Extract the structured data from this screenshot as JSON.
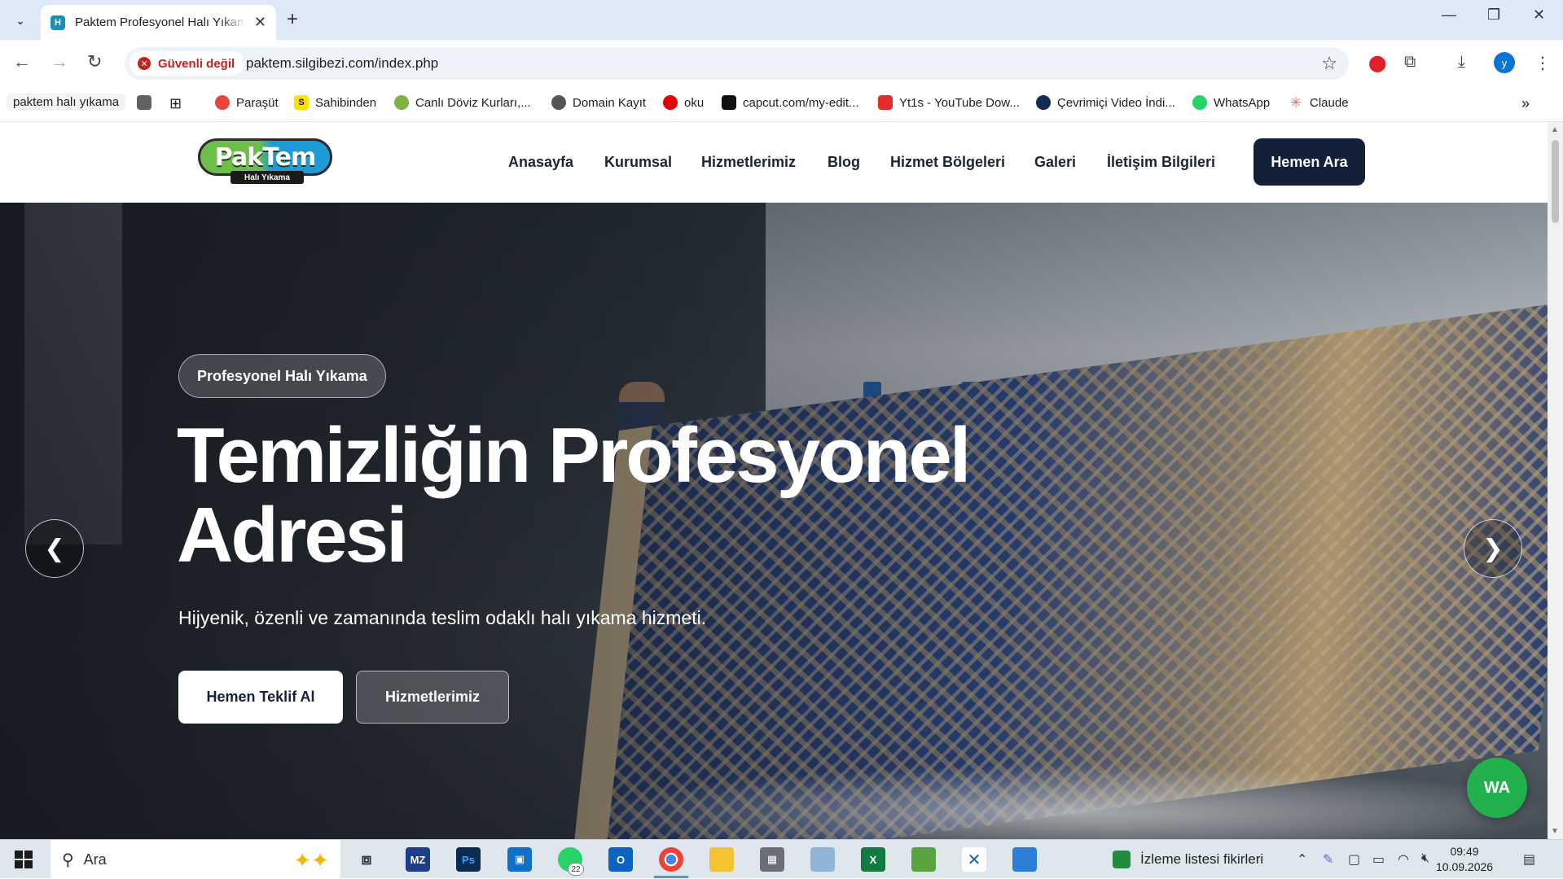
{
  "browser": {
    "tab_title": "Paktem Profesyonel Halı Yıkama",
    "tab_favicon": "H",
    "security_label": "Güvenli değil",
    "url": "paktem.silgibezi.com/index.php",
    "profile_initial": "y",
    "bookmarks": [
      {
        "label": "paktem halı yıkama",
        "icon": "",
        "color": ""
      },
      {
        "label": "Paraşüt",
        "icon": "parasut-icon",
        "color": "#e8453c"
      },
      {
        "label": "Sahibinden",
        "icon": "sahibinden-icon",
        "color": "#ffe000"
      },
      {
        "label": "Canlı Döviz Kurları,...",
        "icon": "doviz-icon",
        "color": "#7cb342"
      },
      {
        "label": "Domain Kayıt",
        "icon": "globe-icon",
        "color": "#555555"
      },
      {
        "label": "oku",
        "icon": "vodafone-icon",
        "color": "#e60000"
      },
      {
        "label": "capcut.com/my-edit...",
        "icon": "capcut-icon",
        "color": "#111111"
      },
      {
        "label": "Yt1s - YouTube Dow...",
        "icon": "yt1s-icon",
        "color": "#e52d27"
      },
      {
        "label": "Çevrimiçi Video İndi...",
        "icon": "video-downloader-icon",
        "color": "#0d2f4f"
      },
      {
        "label": "WhatsApp",
        "icon": "whatsapp-icon",
        "color": "#25d366"
      },
      {
        "label": "Claude",
        "icon": "claude-icon",
        "color": "#d97757"
      }
    ]
  },
  "site": {
    "logo_text": "PakTem",
    "logo_subtext": "Halı Yıkama",
    "nav": [
      "Anasayfa",
      "Kurumsal",
      "Hizmetlerimiz",
      "Blog",
      "Hizmet Bölgeleri",
      "Galeri",
      "İletişim Bilgileri"
    ],
    "cta": "Hemen Ara"
  },
  "hero": {
    "badge": "Profesyonel Halı Yıkama",
    "title": "Temizliğin Profesyonel Adresi",
    "subtitle": "Hijyenik, özenli ve zamanında teslim odaklı halı yıkama hizmeti.",
    "primary_button": "Hemen Teklif Al",
    "secondary_button": "Hizmetlerimiz",
    "prev_arrow": "❮",
    "next_arrow": "❯",
    "whatsapp_button": "WA"
  },
  "taskbar": {
    "search_placeholder": "Ara",
    "whatsapp_badge": "22",
    "news_label": "İzleme listesi fikirleri",
    "time": "09:49",
    "date": "10.09.2026"
  }
}
